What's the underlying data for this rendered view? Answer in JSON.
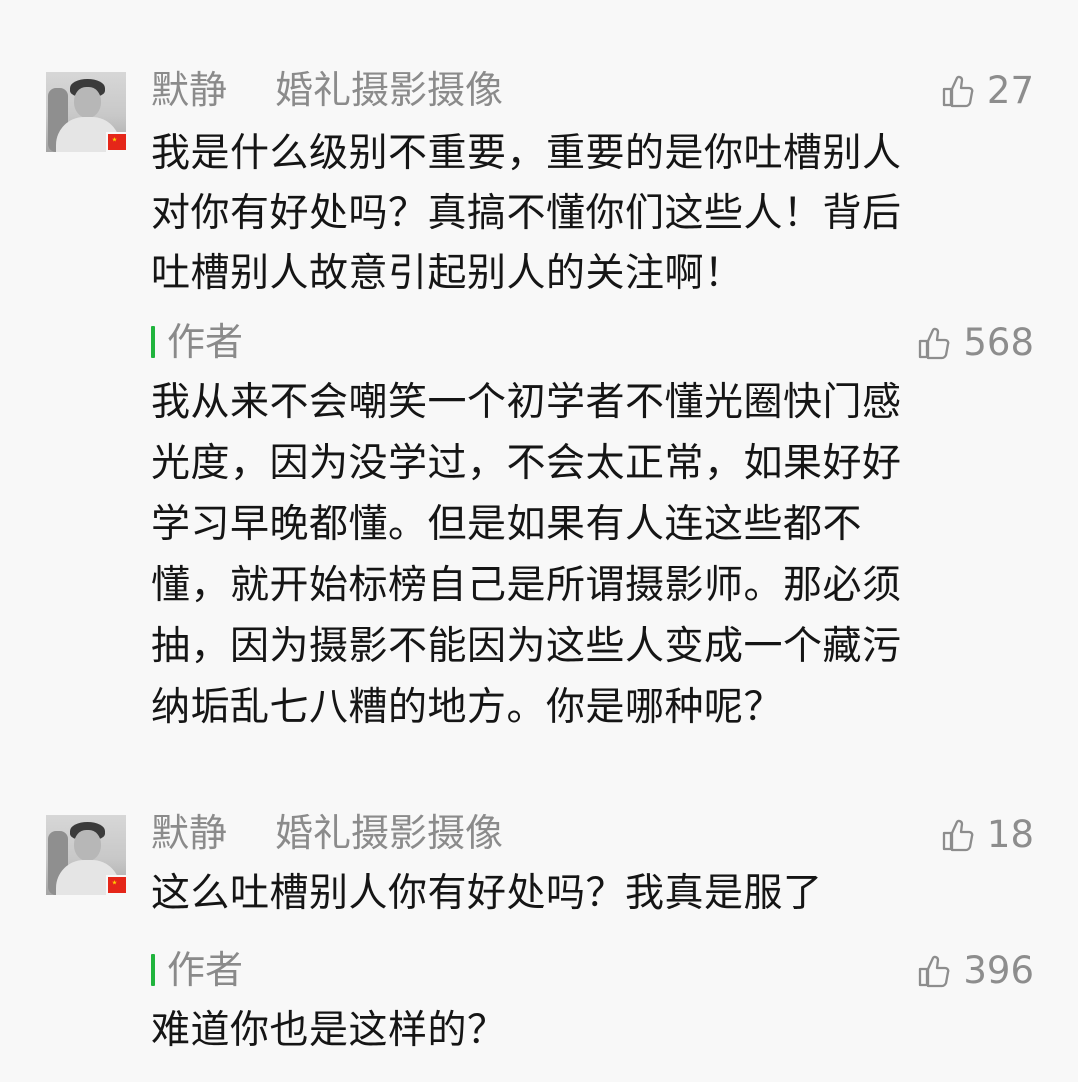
{
  "comments": [
    {
      "author": "默静",
      "tag": "婚礼摄影摄像",
      "likes": "27",
      "text_lines": [
        "我是什么级别不重要，重要的是你吐槽别人",
        "对你有好处吗？真搞不懂你们这些人！背后",
        "吐槽别人故意引起别人的关注啊！"
      ],
      "reply": {
        "label": "作者",
        "likes": "568",
        "text_lines": [
          "我从来不会嘲笑一个初学者不懂光圈快门感",
          "光度，因为没学过，不会太正常，如果好好",
          "学习早晚都懂。但是如果有人连这些都不",
          "懂，就开始标榜自己是所谓摄影师。那必须",
          "抽，因为摄影不能因为这些人变成一个藏污",
          "纳垢乱七八糟的地方。你是哪种呢？"
        ]
      }
    },
    {
      "author": "默静",
      "tag": "婚礼摄影摄像",
      "likes": "18",
      "text_lines": [
        "这么吐槽别人你有好处吗？我真是服了"
      ],
      "reply": {
        "label": "作者",
        "likes": "396",
        "text_lines": [
          "难道你也是这样的？"
        ]
      }
    }
  ],
  "icons": {
    "avatar": "user-avatar-icon",
    "flag": "china-flag-icon",
    "like": "thumbs-up-icon",
    "author_marker": "green-author-marker-icon"
  },
  "colors": {
    "background": "#f8f8f8",
    "text": "#151515",
    "muted": "#8b8b8b",
    "author_green": "#20b43d",
    "flag_red": "#e52619",
    "flag_yellow": "#ffd400"
  }
}
